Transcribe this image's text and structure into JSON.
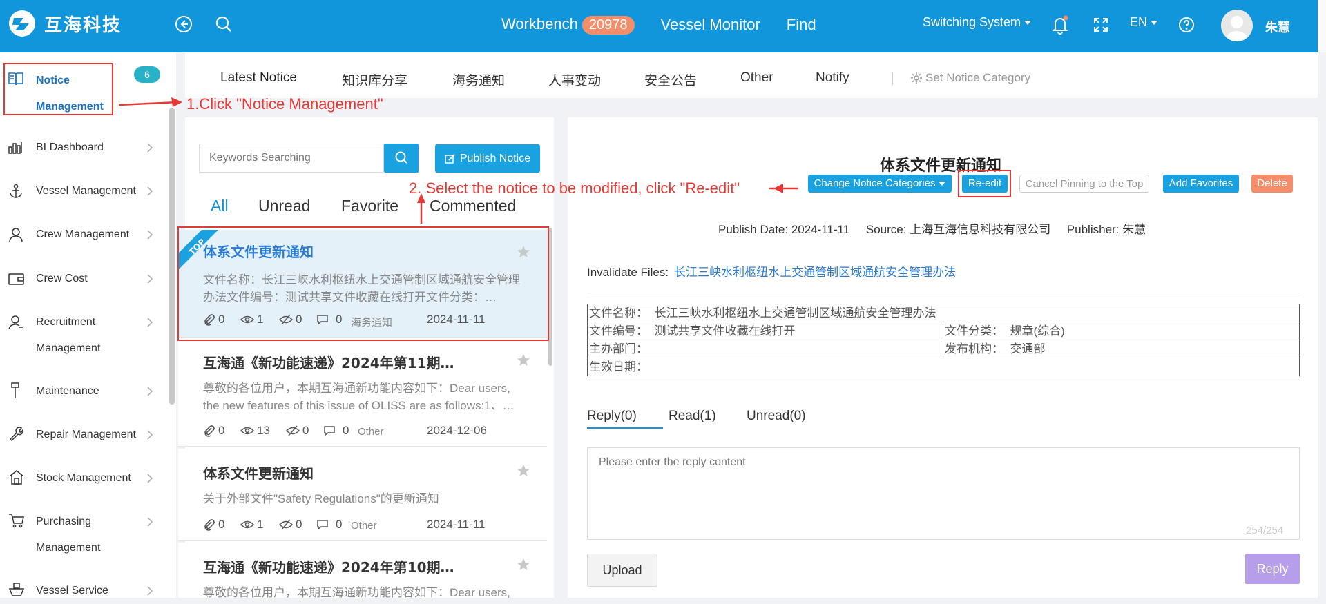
{
  "app": {
    "brand": "互海科技"
  },
  "topnav": {
    "workbench": "Workbench",
    "workbench_badge": "20978",
    "vessel_monitor": "Vessel Monitor",
    "find": "Find",
    "switching_system": "Switching System",
    "language": "EN",
    "username": "朱慧"
  },
  "sidebar": {
    "notice_line1": "Notice",
    "notice_line2": "Management",
    "notice_badge": "6",
    "items": [
      {
        "label": "BI Dashboard",
        "icon": "bar-chart-icon"
      },
      {
        "label": "Vessel Management",
        "icon": "anchor-icon"
      },
      {
        "label": "Crew Management",
        "icon": "person-icon"
      },
      {
        "label": "Crew Cost",
        "icon": "wallet-icon"
      },
      {
        "label": "Recruitment",
        "label2": "Management",
        "icon": "recruit-icon"
      },
      {
        "label": "Maintenance",
        "icon": "brush-icon"
      },
      {
        "label": "Repair Management",
        "icon": "wrench-icon"
      },
      {
        "label": "Stock Management",
        "icon": "house-icon"
      },
      {
        "label": "Purchasing",
        "label2": "Management",
        "icon": "cart-icon"
      },
      {
        "label": "Vessel Service",
        "icon": "ship-icon"
      }
    ]
  },
  "tabs": [
    "Latest Notice",
    "知识库分享",
    "海务通知",
    "人事变动",
    "安全公告",
    "Other",
    "Notify"
  ],
  "set_category": "Set Notice Category",
  "list": {
    "search_placeholder": "Keywords Searching",
    "publish_label": "Publish Notice",
    "filters": [
      "All",
      "Unread",
      "Favorite",
      "Commented"
    ],
    "top_ribbon": "TOP",
    "notices": [
      {
        "title": "体系文件更新通知",
        "desc": "文件名称：长江三峡水利枢纽水上交通管制区域通航安全管理办法文件编号：测试共享文件收藏在线打开文件分类：…",
        "attach": "0",
        "views": "1",
        "unread": "0",
        "comments": "0",
        "category": "海务通知",
        "date": "2024-11-11"
      },
      {
        "title": "互海通《新功能速递》2024年第11期…",
        "desc": "尊敬的各位用户，本期互海通新功能内容如下：Dear users, the new features of this issue of OLISS are as follows:1、…",
        "attach": "0",
        "views": "13",
        "unread": "0",
        "comments": "0",
        "category": "Other",
        "date": "2024-12-06"
      },
      {
        "title": "体系文件更新通知",
        "desc": "关于外部文件\"Safety Regulations\"的更新通知",
        "attach": "0",
        "views": "1",
        "unread": "0",
        "comments": "0",
        "category": "Other",
        "date": "2024-11-11"
      },
      {
        "title": "互海通《新功能速递》2024年第10期…",
        "desc": "尊敬的各位用户，本期互海通新功能内容如下：Dear users,",
        "attach": "",
        "views": "",
        "unread": "",
        "comments": "",
        "category": "",
        "date": ""
      }
    ]
  },
  "detail": {
    "title": "体系文件更新通知",
    "change_category": "Change Notice Categories",
    "reedit": "Re-edit",
    "cancel_pin": "Cancel Pinning to the Top",
    "add_favorites": "Add Favorites",
    "delete": "Delete",
    "publish_info": "Publish Date: 2024-11-11     Source: 上海互海信息科技有限公司     Publisher: 朱慧",
    "invalidate_label": "Invalidate Files:",
    "invalidate_link": "长江三峡水利枢纽水上交通管制区域通航安全管理办法",
    "table": {
      "r1": "文件名称：  长江三峡水利枢纽水上交通管制区域通航安全管理办法",
      "r2a": "文件编号：  测试共享文件收藏在线打开",
      "r2b": "文件分类：  规章(综合)",
      "r3a": "主办部门：",
      "r3b": "发布机构：  交通部",
      "r4": "生效日期："
    },
    "reply_tabs": [
      "Reply(0)",
      "Read(1)",
      "Unread(0)"
    ],
    "reply_placeholder": "Please enter the reply content",
    "counter": "254/254",
    "upload": "Upload",
    "reply": "Reply"
  },
  "annotations": {
    "step1": "1.Click \"Notice Management\"",
    "step2": "2. Select the notice to be modified, click \"Re-edit\""
  },
  "colors": {
    "primary": "#1296db",
    "annotation": "#e53935",
    "delete": "#f38e6a",
    "reply": "#b69eea"
  }
}
